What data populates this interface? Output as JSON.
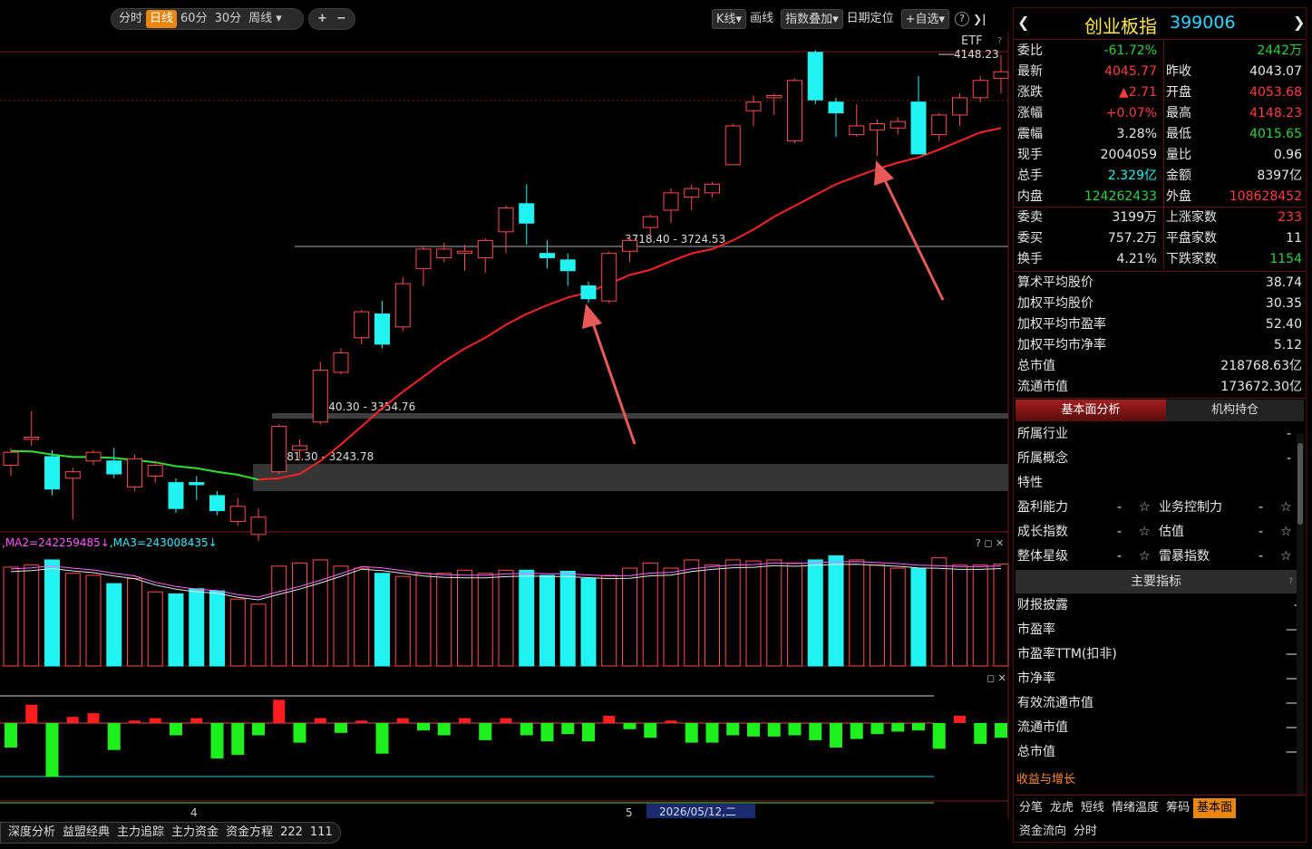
{
  "toolbar": {
    "period_tabs": [
      "分时",
      "日线",
      "60分",
      "30分",
      "周线"
    ],
    "active_period": "日线",
    "weekly_dropdown_arrow": "▾",
    "zoom_in": "+",
    "zoom_out": "−",
    "kline_label": "K线",
    "draw_label": "画线",
    "overlay_label": "指数叠加",
    "date_locate_label": "日期定位",
    "watchlist_label": "+自选",
    "help_label": "?",
    "collapse_label": "❯|"
  },
  "main_chart": {
    "etf_label": "ETF",
    "help_mark": "?",
    "high_label": "4148.23",
    "zones": [
      {
        "text": "3718.40 - 3724.53"
      },
      {
        "text": "3340.30 - 3354.76"
      },
      {
        "text": "3181.30 - 3243.78"
      }
    ]
  },
  "volume_panel": {
    "ma2_label": ",MA2=242259485↓",
    "ma3_label": ",MA3=243008435↓",
    "controls": "? ◻ ✕"
  },
  "macd_panel": {
    "controls": "◻ ✕"
  },
  "x_axis": {
    "month_4": "4",
    "month_5": "5",
    "cursor_date": "2026/05/12,二"
  },
  "bottom_tabs": [
    "深度分析",
    "益盟经典",
    "主力追踪",
    "主力资金",
    "资金方程",
    "222",
    "111"
  ],
  "chart_data": {
    "type": "candlestick",
    "ylim": [
      3090,
      4148.23
    ],
    "candles": [
      {
        "o": 3200,
        "c": 3230,
        "h": 3240,
        "l": 3175
      },
      {
        "o": 3260,
        "c": 3265,
        "h": 3325,
        "l": 3245
      },
      {
        "o": 3220,
        "c": 3145,
        "h": 3235,
        "l": 3130
      },
      {
        "o": 3170,
        "c": 3185,
        "h": 3195,
        "l": 3075
      },
      {
        "o": 3210,
        "c": 3230,
        "h": 3235,
        "l": 3200
      },
      {
        "o": 3210,
        "c": 3180,
        "h": 3240,
        "l": 3170
      },
      {
        "o": 3150,
        "c": 3215,
        "h": 3225,
        "l": 3140
      },
      {
        "o": 3175,
        "c": 3200,
        "h": 3210,
        "l": 3160
      },
      {
        "o": 3160,
        "c": 3100,
        "h": 3170,
        "l": 3090
      },
      {
        "o": 3160,
        "c": 3155,
        "h": 3175,
        "l": 3120
      },
      {
        "o": 3130,
        "c": 3095,
        "h": 3140,
        "l": 3085
      },
      {
        "o": 3070,
        "c": 3105,
        "h": 3125,
        "l": 3060
      },
      {
        "o": 3040,
        "c": 3080,
        "h": 3100,
        "l": 3025
      },
      {
        "o": 3185,
        "c": 3290,
        "h": 3295,
        "l": 3180
      },
      {
        "o": 3235,
        "c": 3245,
        "h": 3260,
        "l": 3215
      },
      {
        "o": 3300,
        "c": 3420,
        "h": 3440,
        "l": 3295
      },
      {
        "o": 3415,
        "c": 3460,
        "h": 3470,
        "l": 3410
      },
      {
        "o": 3495,
        "c": 3555,
        "h": 3560,
        "l": 3480
      },
      {
        "o": 3550,
        "c": 3480,
        "h": 3580,
        "l": 3470
      },
      {
        "o": 3520,
        "c": 3620,
        "h": 3635,
        "l": 3510
      },
      {
        "o": 3655,
        "c": 3700,
        "h": 3705,
        "l": 3615
      },
      {
        "o": 3680,
        "c": 3700,
        "h": 3715,
        "l": 3670
      },
      {
        "o": 3690,
        "c": 3695,
        "h": 3710,
        "l": 3650
      },
      {
        "o": 3680,
        "c": 3720,
        "h": 3725,
        "l": 3645
      },
      {
        "o": 3740,
        "c": 3795,
        "h": 3800,
        "l": 3690
      },
      {
        "o": 3805,
        "c": 3760,
        "h": 3850,
        "l": 3710
      },
      {
        "o": 3690,
        "c": 3680,
        "h": 3720,
        "l": 3655
      },
      {
        "o": 3675,
        "c": 3650,
        "h": 3690,
        "l": 3615
      },
      {
        "o": 3615,
        "c": 3585,
        "h": 3625,
        "l": 3575
      },
      {
        "o": 3580,
        "c": 3690,
        "h": 3695,
        "l": 3575
      },
      {
        "o": 3695,
        "c": 3720,
        "h": 3730,
        "l": 3670
      },
      {
        "o": 3750,
        "c": 3775,
        "h": 3780,
        "l": 3730
      },
      {
        "o": 3790,
        "c": 3830,
        "h": 3840,
        "l": 3760
      },
      {
        "o": 3820,
        "c": 3840,
        "h": 3850,
        "l": 3790
      },
      {
        "o": 3830,
        "c": 3850,
        "h": 3855,
        "l": 3820
      },
      {
        "o": 3895,
        "c": 3985,
        "h": 3990,
        "l": 3895
      },
      {
        "o": 4020,
        "c": 4040,
        "h": 4055,
        "l": 3985
      },
      {
        "o": 4050,
        "c": 4055,
        "h": 4060,
        "l": 4010
      },
      {
        "o": 3950,
        "c": 4090,
        "h": 4095,
        "l": 3945
      },
      {
        "o": 4155,
        "c": 4045,
        "h": 4160,
        "l": 4035
      },
      {
        "o": 4040,
        "c": 4015,
        "h": 4050,
        "l": 3960
      },
      {
        "o": 3965,
        "c": 3985,
        "h": 4035,
        "l": 3960
      },
      {
        "o": 3975,
        "c": 3990,
        "h": 4000,
        "l": 3915
      },
      {
        "o": 3980,
        "c": 3995,
        "h": 4005,
        "l": 3965
      },
      {
        "o": 4040,
        "c": 3920,
        "h": 4100,
        "l": 3920
      },
      {
        "o": 3965,
        "c": 4010,
        "h": 4015,
        "l": 3950
      },
      {
        "o": 4010,
        "c": 4050,
        "h": 4060,
        "l": 3985
      },
      {
        "o": 4050,
        "c": 4090,
        "h": 4100,
        "l": 4040
      },
      {
        "o": 4095,
        "c": 4110,
        "h": 4148.23,
        "l": 4060
      }
    ],
    "ma": [
      3233,
      3232,
      3225,
      3219,
      3219,
      3217,
      3212,
      3207,
      3198,
      3193,
      3185,
      3178,
      3167,
      3170,
      3180,
      3210,
      3248,
      3290,
      3332,
      3370,
      3405,
      3440,
      3470,
      3495,
      3525,
      3550,
      3570,
      3588,
      3600,
      3620,
      3640,
      3652,
      3672,
      3690,
      3700,
      3720,
      3745,
      3775,
      3800,
      3825,
      3850,
      3868,
      3885,
      3900,
      3912,
      3930,
      3950,
      3970,
      3980
    ],
    "ma_bull_from": 12,
    "volume": [
      96,
      98,
      103,
      90,
      88,
      80,
      85,
      72,
      70,
      75,
      73,
      65,
      60,
      97,
      100,
      103,
      97,
      95,
      90,
      87,
      90,
      90,
      93,
      90,
      93,
      93,
      88,
      92,
      85,
      88,
      95,
      100,
      95,
      103,
      98,
      103,
      102,
      103,
      100,
      103,
      107,
      103,
      98,
      95,
      95,
      105,
      98,
      98,
      99
    ],
    "macd": [
      -2,
      1.5,
      -4.4,
      0.5,
      0.8,
      -2.2,
      0.2,
      0.4,
      -1,
      0.4,
      -2.9,
      -2.6,
      -1,
      1.9,
      -1.6,
      0.4,
      -0.8,
      0.2,
      -2.5,
      0.4,
      -0.6,
      -1,
      0.4,
      -1.4,
      0.4,
      -1,
      -1.5,
      -0.9,
      -1.5,
      0.6,
      -0.5,
      -1.2,
      0.2,
      -1.6,
      -1.6,
      -1,
      -1.1,
      -1.1,
      -1,
      -1.4,
      -2,
      -1.3,
      -0.9,
      -0.7,
      -0.6,
      -2.1,
      0.6,
      -1.7,
      -1.2
    ]
  },
  "right_panel": {
    "prev_arrow": "❮",
    "next_arrow": "❯",
    "index_name": "创业板指",
    "index_code": "399006",
    "quote_rows": [
      {
        "l1": "委比",
        "v1": "-61.72%",
        "c1": "green",
        "l2": "",
        "v2": "2442万",
        "c2": "green"
      },
      {
        "l1": "最新",
        "v1": "4045.77",
        "c1": "red",
        "l2": "昨收",
        "v2": "4043.07",
        "c2": "white"
      },
      {
        "l1": "涨跌",
        "v1": "▲2.71",
        "c1": "red",
        "l2": "开盘",
        "v2": "4053.68",
        "c2": "red"
      },
      {
        "l1": "涨幅",
        "v1": "+0.07%",
        "c1": "red",
        "l2": "最高",
        "v2": "4148.23",
        "c2": "red"
      },
      {
        "l1": "震幅",
        "v1": "3.28%",
        "c1": "white",
        "l2": "最低",
        "v2": "4015.65",
        "c2": "green"
      },
      {
        "l1": "现手",
        "v1": "2004059",
        "c1": "white",
        "l2": "量比",
        "v2": "0.96",
        "c2": "white"
      },
      {
        "l1": "总手",
        "v1": "2.329亿",
        "c1": "cyan",
        "l2": "金额",
        "v2": "8397亿",
        "c2": "white"
      },
      {
        "l1": "内盘",
        "v1": "124262433",
        "c1": "green",
        "l2": "外盘",
        "v2": "108628452",
        "c2": "red"
      }
    ],
    "order_rows": [
      {
        "l1": "委卖",
        "v1": "3199万",
        "c1": "white",
        "l2": "上涨家数",
        "v2": "233",
        "c2": "red"
      },
      {
        "l1": "委买",
        "v1": "757.2万",
        "c1": "white",
        "l2": "平盘家数",
        "v2": "11",
        "c2": "white"
      },
      {
        "l1": "换手",
        "v1": "4.21%",
        "c1": "white",
        "l2": "下跌家数",
        "v2": "1154",
        "c2": "green"
      }
    ],
    "stats": [
      {
        "label": "算术平均股价",
        "value": "38.74"
      },
      {
        "label": "加权平均股价",
        "value": "30.35"
      },
      {
        "label": "加权平均市盈率",
        "value": "52.40"
      },
      {
        "label": "加权平均市净率",
        "value": "5.12"
      },
      {
        "label": "总市值",
        "value": "218768.63亿"
      },
      {
        "label": "流通市值",
        "value": "173672.30亿"
      }
    ],
    "tabs": [
      "基本面分析",
      "机构持仓"
    ],
    "basics": [
      {
        "label": "所属行业",
        "value": "-"
      },
      {
        "label": "所属概念",
        "value": "-"
      },
      {
        "label": "特性",
        "value": ""
      }
    ],
    "ratings": [
      {
        "l1": "盈利能力",
        "v1": "-",
        "l2": "业务控制力",
        "v2": "-"
      },
      {
        "l1": "成长指数",
        "v1": "-",
        "l2": "估值",
        "v2": "-"
      },
      {
        "l1": "整体星级",
        "v1": "-",
        "l2": "雷暴指数",
        "v2": "-"
      }
    ],
    "main_indicators_title": "主要指标",
    "indicators": [
      {
        "label": "财报披露",
        "value": "-"
      },
      {
        "label": "市盈率",
        "value": "—"
      },
      {
        "label": "市盈率TTM(扣非)",
        "value": "—"
      },
      {
        "label": "市净率",
        "value": "—"
      },
      {
        "label": "有效流通市值",
        "value": "—"
      },
      {
        "label": "流通市值",
        "value": "—"
      },
      {
        "label": "总市值",
        "value": "—"
      }
    ],
    "income_growth": "收益与增长",
    "bottom_tabs_row1": [
      "分笔",
      "龙虎",
      "短线",
      "情绪温度",
      "筹码",
      "基本面"
    ],
    "active_bottom_tab": "基本面",
    "bottom_tabs_row2": [
      "资金流向",
      "分时"
    ]
  }
}
